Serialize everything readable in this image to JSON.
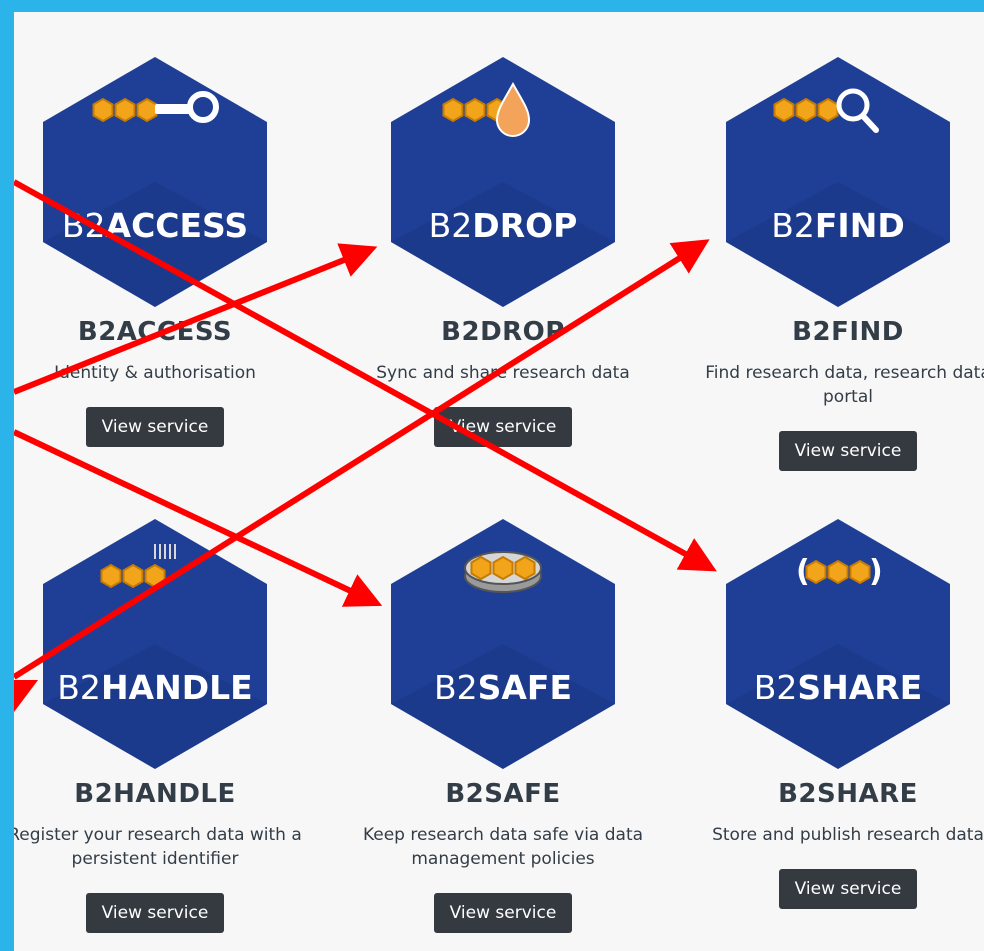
{
  "button_label": "View service",
  "services": [
    {
      "title": "B2ACCESS",
      "hex_prefix": "B2",
      "hex_name": "ACCESS",
      "description": "Identity & authorisation",
      "icon": "key-icon"
    },
    {
      "title": "B2DROP",
      "hex_prefix": "B2",
      "hex_name": "DROP",
      "description": "Sync and share research data",
      "icon": "drop-icon"
    },
    {
      "title": "B2FIND",
      "hex_prefix": "B2",
      "hex_name": "FIND",
      "description": "Find research data, research data portal",
      "icon": "magnifier-icon"
    },
    {
      "title": "B2HANDLE",
      "hex_prefix": "B2",
      "hex_name": "HANDLE",
      "description": "Register your research data with a persistent identifier",
      "icon": "handle-icon"
    },
    {
      "title": "B2SAFE",
      "hex_prefix": "B2",
      "hex_name": "SAFE",
      "description": "Keep research data safe via data management policies",
      "icon": "safe-disk-icon"
    },
    {
      "title": "B2SHARE",
      "hex_prefix": "B2",
      "hex_name": "SHARE",
      "description": "Store and publish research data",
      "icon": "share-brackets-icon"
    }
  ],
  "colors": {
    "frame": "#2bb4ea",
    "hex_blue": "#1f3f96",
    "hex_dark": "#17307a",
    "honeycomb": "#f2a51a",
    "button": "#343a40",
    "title_text": "#333d47",
    "annotation_arrow": "#ff0000"
  }
}
